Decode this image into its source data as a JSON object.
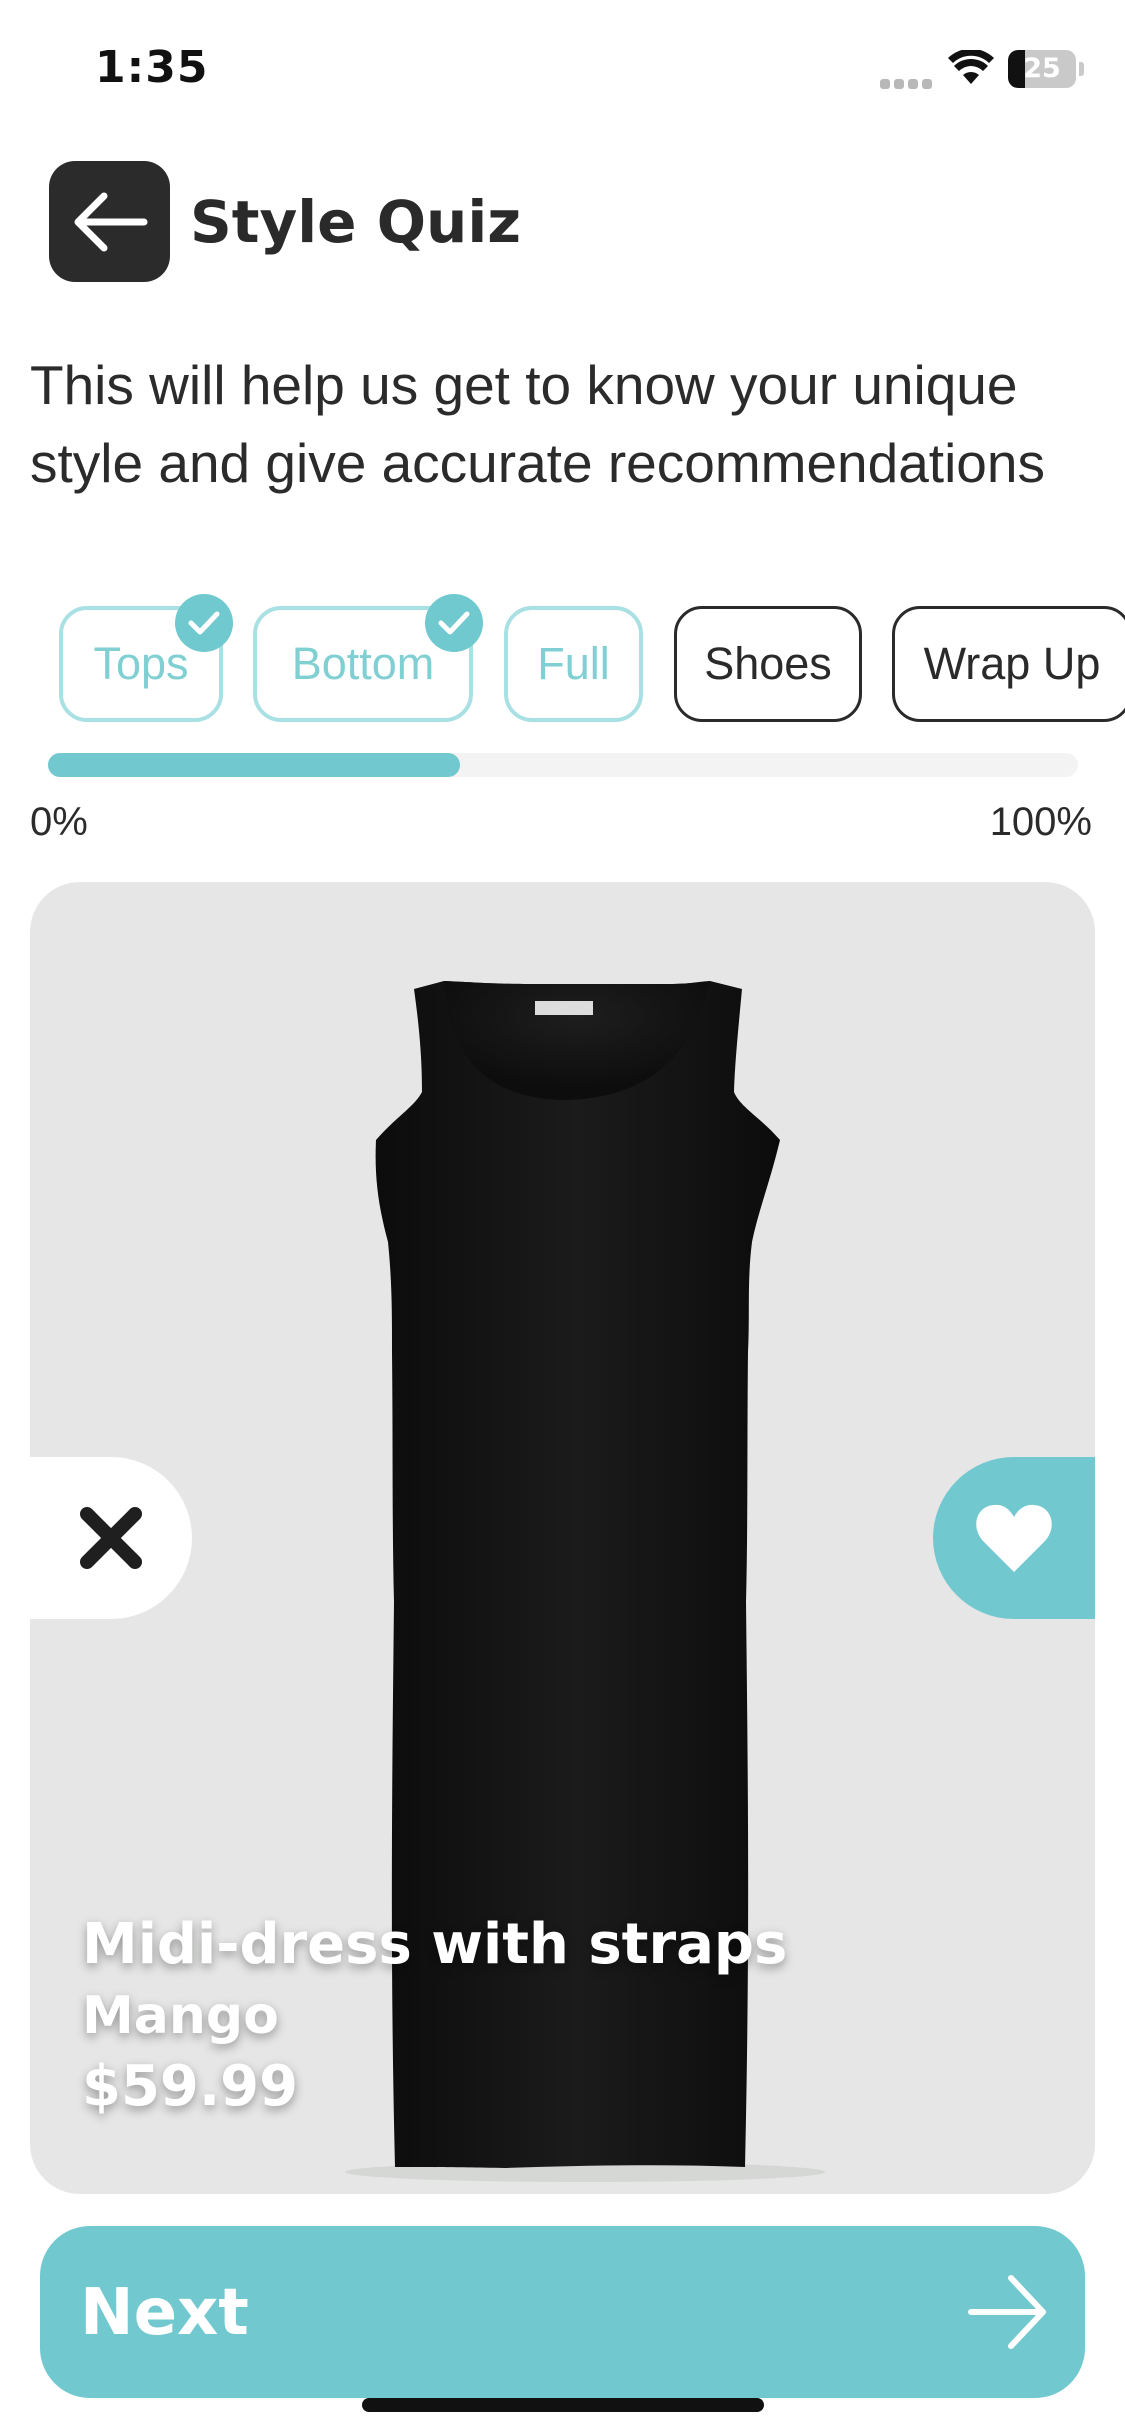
{
  "status_bar": {
    "time": "1:35",
    "battery_level": "25",
    "icons": [
      "signal-icon",
      "wifi-icon",
      "battery-icon"
    ]
  },
  "header": {
    "title": "Style Quiz",
    "back_icon": "arrow-left-icon"
  },
  "intro": "This will help us get to know your unique style and give accurate recommendations",
  "categories": [
    {
      "label": "Tops",
      "completed": true
    },
    {
      "label": "Bottom",
      "completed": true
    },
    {
      "label": "Full",
      "completed": true
    },
    {
      "label": "Shoes",
      "completed": false
    },
    {
      "label": "Wrap Up",
      "completed": false
    }
  ],
  "progress": {
    "value_fraction": 0.4,
    "min_label": "0%",
    "max_label": "100%"
  },
  "product": {
    "name": "Midi-dress with straps",
    "brand": "Mango",
    "price": "$59.99",
    "image_icon": "black-midi-dress-image"
  },
  "actions": {
    "dislike_icon": "close-x-icon",
    "like_icon": "heart-icon"
  },
  "next": {
    "label": "Next",
    "icon": "arrow-right-icon"
  },
  "colors": {
    "accent": "#71c9cf",
    "accent_light": "#a9e0e3",
    "dark": "#2b2b2b",
    "card_bg": "#e5e6e5"
  }
}
